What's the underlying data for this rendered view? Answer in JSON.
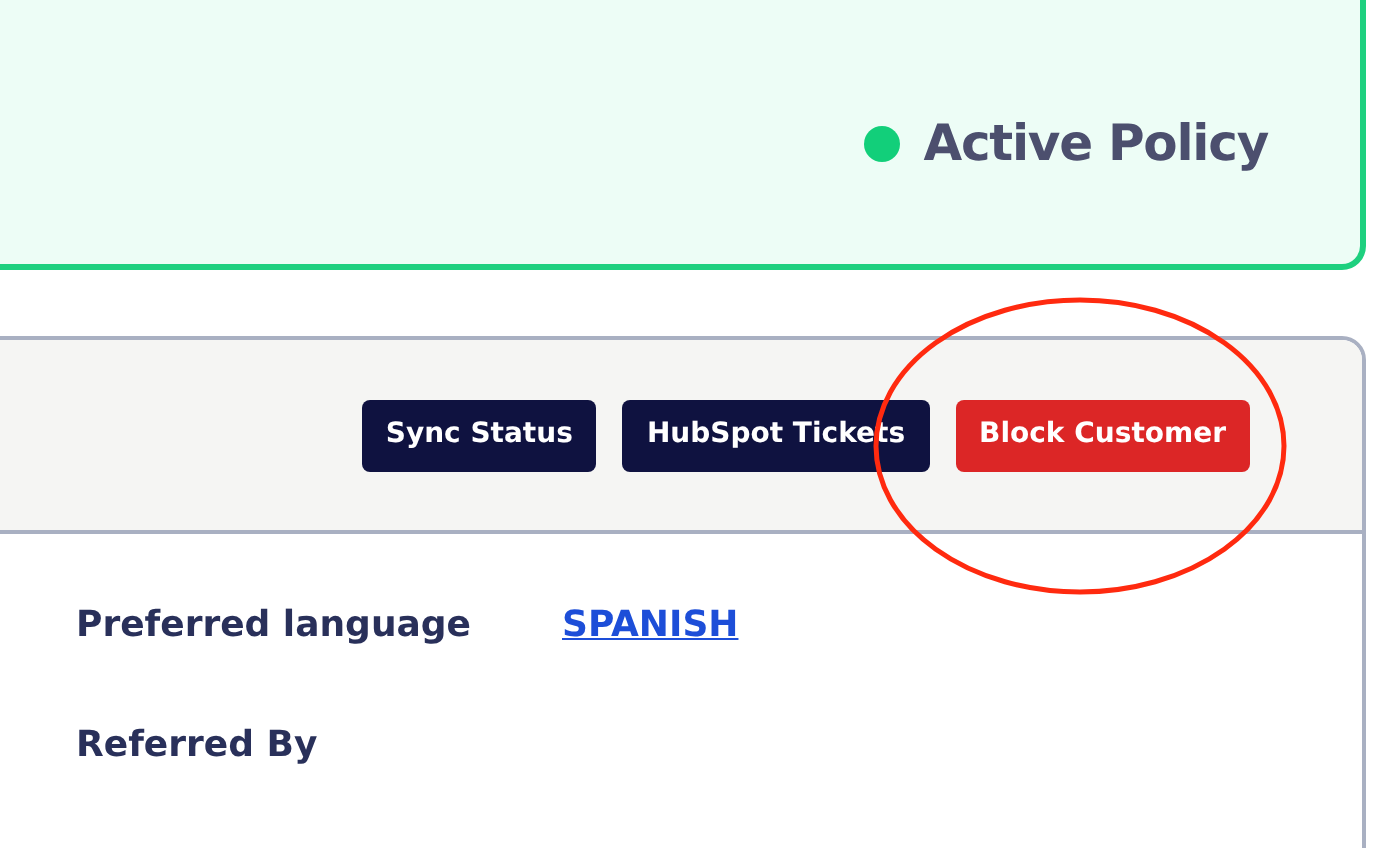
{
  "policy_status": {
    "label": "Active Policy",
    "color": "#12cf7a"
  },
  "actions": [
    {
      "label": "Sync Status",
      "kind": "dark"
    },
    {
      "label": "HubSpot Tickets",
      "kind": "dark"
    },
    {
      "label": "Block Customer",
      "kind": "danger"
    }
  ],
  "fields": [
    {
      "label": "Preferred language",
      "value": "SPANISH"
    },
    {
      "label": "Referred By"
    }
  ]
}
